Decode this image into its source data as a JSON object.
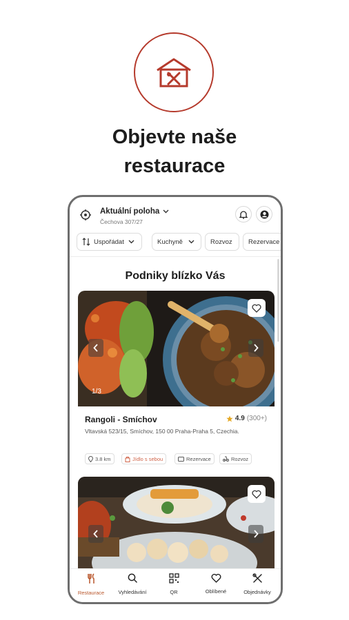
{
  "headline": {
    "line1": "Objevte naše",
    "line2": "restaurace"
  },
  "colors": {
    "brand": "#b53a2c",
    "accent": "#d88a2e",
    "nav_active": "#b9562b"
  },
  "location": {
    "title": "Aktuální poloha",
    "subtitle": "Čechova 307/27"
  },
  "filters": [
    {
      "label": "Uspořádat",
      "icon": "sort-icon"
    },
    {
      "label": "Kuchyně",
      "icon": "chevron-down-icon"
    },
    {
      "label": "Rozvoz"
    },
    {
      "label": "Rezervace"
    }
  ],
  "section_title": "Podniky blízko Vás",
  "restaurant": {
    "name": "Rangoli - Smíchov",
    "rating": "4.9",
    "reviews": "(300+)",
    "address": "Vltavská 523/15, Smíchov, 150 00 Praha-Praha 5, Czechia.",
    "image_counter": "1/3",
    "tags": [
      {
        "label": "3.8 km",
        "icon": "pin-icon"
      },
      {
        "label": "Jídlo s sebou",
        "icon": "bag-icon"
      },
      {
        "label": "Rezervace",
        "icon": "ticket-icon"
      },
      {
        "label": "Rozvoz",
        "icon": "scooter-icon"
      }
    ]
  },
  "nav": [
    {
      "label": "Restaurace",
      "icon": "restaurant-icon",
      "active": true
    },
    {
      "label": "Vyhledávání",
      "icon": "search-icon"
    },
    {
      "label": "QR",
      "icon": "qr-icon"
    },
    {
      "label": "Oblíbené",
      "icon": "heart-icon"
    },
    {
      "label": "Objednávky",
      "icon": "cutlery-icon"
    }
  ]
}
